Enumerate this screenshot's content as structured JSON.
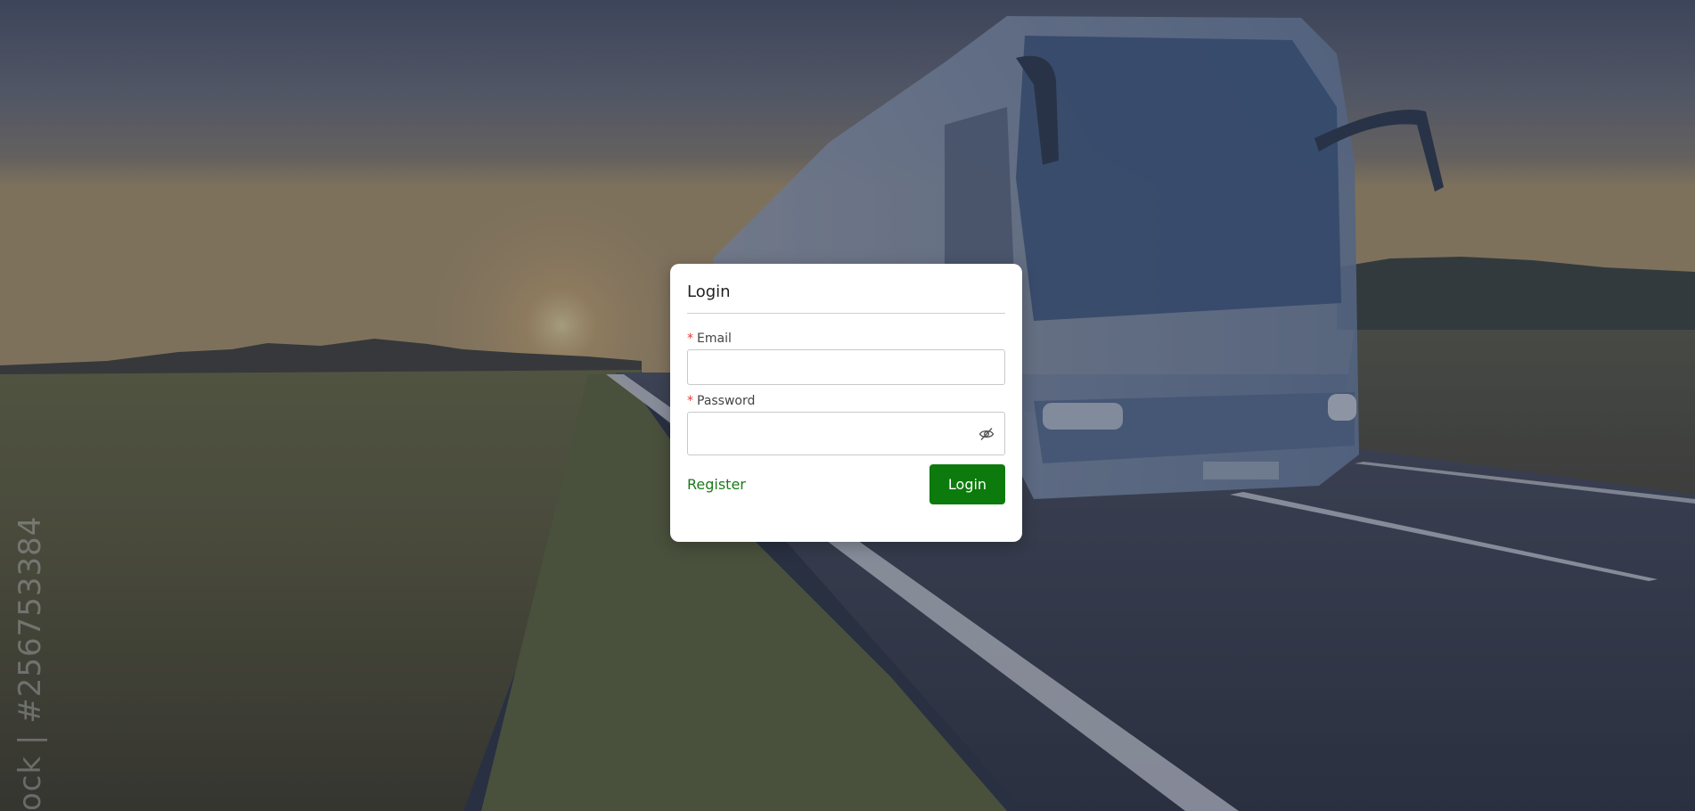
{
  "background": {
    "watermark_id": "ock | #256753384",
    "dim_color": "#28304a"
  },
  "login_form": {
    "title": "Login",
    "email": {
      "required_mark": "*",
      "label": "Email",
      "value": "",
      "placeholder": ""
    },
    "password": {
      "required_mark": "*",
      "label": "Password",
      "value": "",
      "placeholder": "",
      "toggle_icon": "eye-off-icon"
    },
    "register_label": "Register",
    "login_label": "Login"
  },
  "colors": {
    "primary_green": "#0c7a0c",
    "link_green": "#1b7a1b",
    "required_red": "#e53935"
  }
}
